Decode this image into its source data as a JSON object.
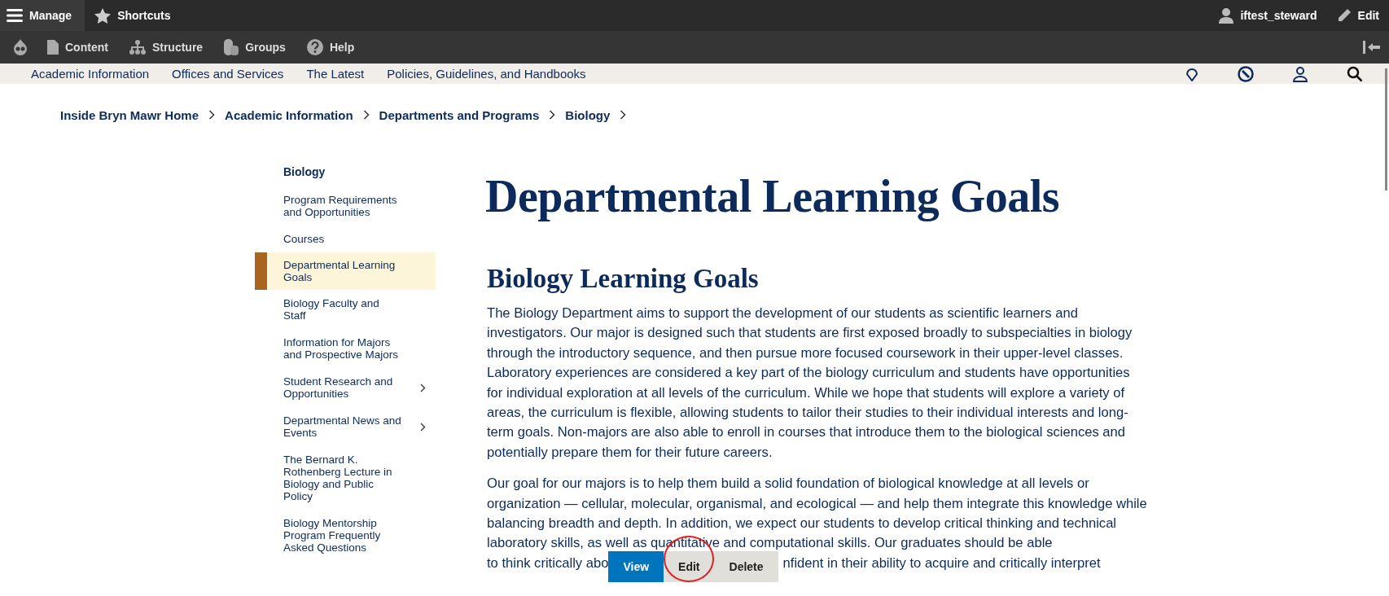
{
  "toolbar": {
    "manage": "Manage",
    "shortcuts": "Shortcuts",
    "user": "iftest_steward",
    "edit": "Edit",
    "items": [
      "Content",
      "Structure",
      "Groups",
      "Help"
    ]
  },
  "nav": [
    "Academic Information",
    "Offices and Services",
    "The Latest",
    "Policies, Guidelines, and Handbooks"
  ],
  "breadcrumb": [
    "Inside Bryn Mawr Home",
    "Academic Information",
    "Departments and Programs",
    "Biology"
  ],
  "sidebar": {
    "title": "Biology",
    "items": [
      {
        "label": "Program Requirements and Opportunities",
        "selected": false,
        "expandable": false
      },
      {
        "label": "Courses",
        "selected": false,
        "expandable": false
      },
      {
        "label": "Departmental Learning Goals",
        "selected": true,
        "expandable": false
      },
      {
        "label": "Biology Faculty and Staff",
        "selected": false,
        "expandable": false
      },
      {
        "label": "Information for Majors and Prospective Majors",
        "selected": false,
        "expandable": false
      },
      {
        "label": "Student Research and Opportunities",
        "selected": false,
        "expandable": true
      },
      {
        "label": "Departmental News and Events",
        "selected": false,
        "expandable": true
      },
      {
        "label": "The Bernard K. Rothenberg Lecture in Biology and Public Policy",
        "selected": false,
        "expandable": false
      },
      {
        "label": "Biology Mentorship Program Frequently Asked Questions",
        "selected": false,
        "expandable": false
      }
    ]
  },
  "title": "Departmental Learning Goals",
  "section_title": "Biology Learning Goals",
  "paragraphs": [
    "The Biology Department aims to support the development of our students as scientific learners and investigators. Our major is designed such that students are first exposed broadly to subspecialties in biology through the introductory sequence, and then pursue more focused coursework in their upper-level classes. Laboratory experiences are considered a key part of the biology curriculum and students have opportunities for individual exploration at all levels of the curriculum. While we hope that students will explore a variety of areas, the curriculum is flexible, allowing students to tailor their studies to their individual interests and long-term goals. Non-majors are also able to enroll in courses that introduce them to the biological sciences and potentially prepare them for their future careers.",
    "Our goal for our majors is to help them build a solid foundation of biological knowledge at all levels or organization — cellular, molecular, organismal, and ecological — and help them integrate this knowledge while balancing breadth and depth. In addition, we expect our students to develop critical thinking and technical laboratory skills, as well as quantitative and computational skills. Our graduates should be able"
  ],
  "last_line": {
    "before": "to think critically abo",
    "after": "nfident in their ability to acquire and critically interpret"
  },
  "tabs": [
    {
      "label": "View",
      "selected": true,
      "circled": false
    },
    {
      "label": "Edit",
      "selected": false,
      "circled": true
    },
    {
      "label": "Delete",
      "selected": false,
      "circled": false
    }
  ]
}
